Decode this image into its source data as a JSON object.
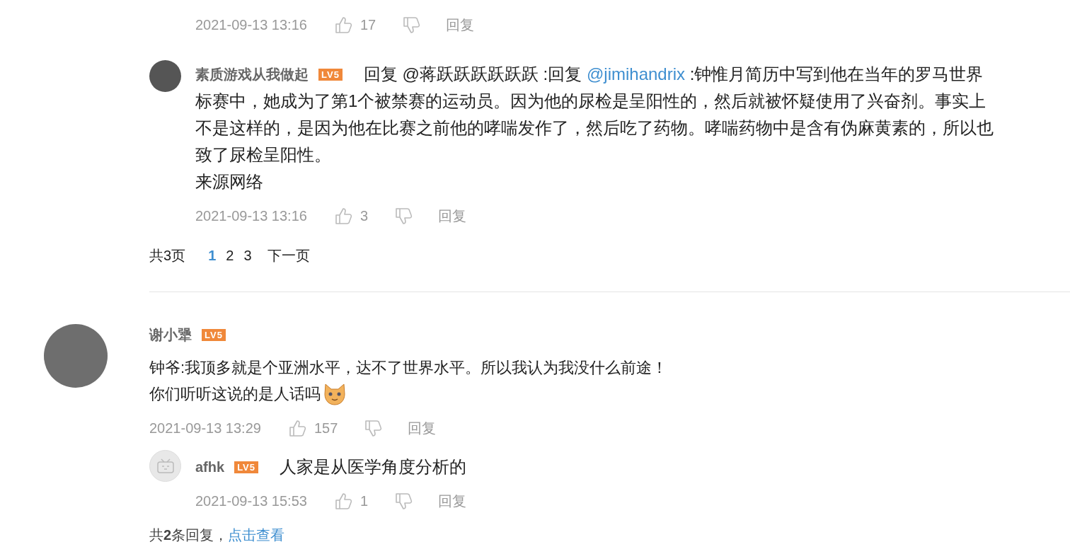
{
  "thread": {
    "replies": [
      {
        "meta": {
          "date": "2021-09-13 13:16",
          "likes": "17",
          "reply": "回复"
        }
      },
      {
        "avatar": {
          "kind": "photo"
        },
        "name": "素质游戏从我做起",
        "level": "LV5",
        "parts": [
          {
            "text": "回复 @蒋跃跃跃跃跃跃 :回复 "
          },
          {
            "text": "@jimihandrix",
            "kind": "link"
          },
          {
            "text": " :钟惟月简历中写到他在当年的罗马世界"
          }
        ],
        "lines": [
          "标赛中，她成为了第1个被禁赛的运动员。因为他的尿检是呈阳性的，然后就被怀疑使用了兴奋剂。事实上",
          "不是这样的，是因为他在比赛之前他的哮喘发作了，然后吃了药物。哮喘药物中是含有伪麻黄素的，所以也",
          "致了尿检呈阳性。",
          "来源网络"
        ],
        "meta": {
          "date": "2021-09-13 13:16",
          "likes": "3",
          "reply": "回复"
        }
      }
    ],
    "pagination": {
      "total": "共3页",
      "pages": [
        {
          "label": "1",
          "selected": true
        },
        {
          "label": "2",
          "selected": false
        },
        {
          "label": "3",
          "selected": false
        }
      ],
      "next": "下一页"
    }
  },
  "comment": {
    "name": "谢小犟",
    "level": "LV5",
    "lines": [
      "钟爷:我顶多就是个亚洲水平，达不了世界水平。所以我认为我没什么前途！",
      "你们听听这说的是人话吗"
    ],
    "emoji_after_last_line": true,
    "meta": {
      "date": "2021-09-13 13:29",
      "likes": "157",
      "reply": "回复"
    },
    "replies": [
      {
        "avatar": {
          "kind": "default"
        },
        "name": "afhk",
        "level": "LV5",
        "parts": [
          {
            "text": "人家是从医学角度分析的"
          }
        ],
        "meta": {
          "date": "2021-09-13 15:53",
          "likes": "1",
          "reply": "回复"
        }
      }
    ],
    "footer": {
      "summary": "共**2**条回复，",
      "link": "点击查看"
    }
  }
}
